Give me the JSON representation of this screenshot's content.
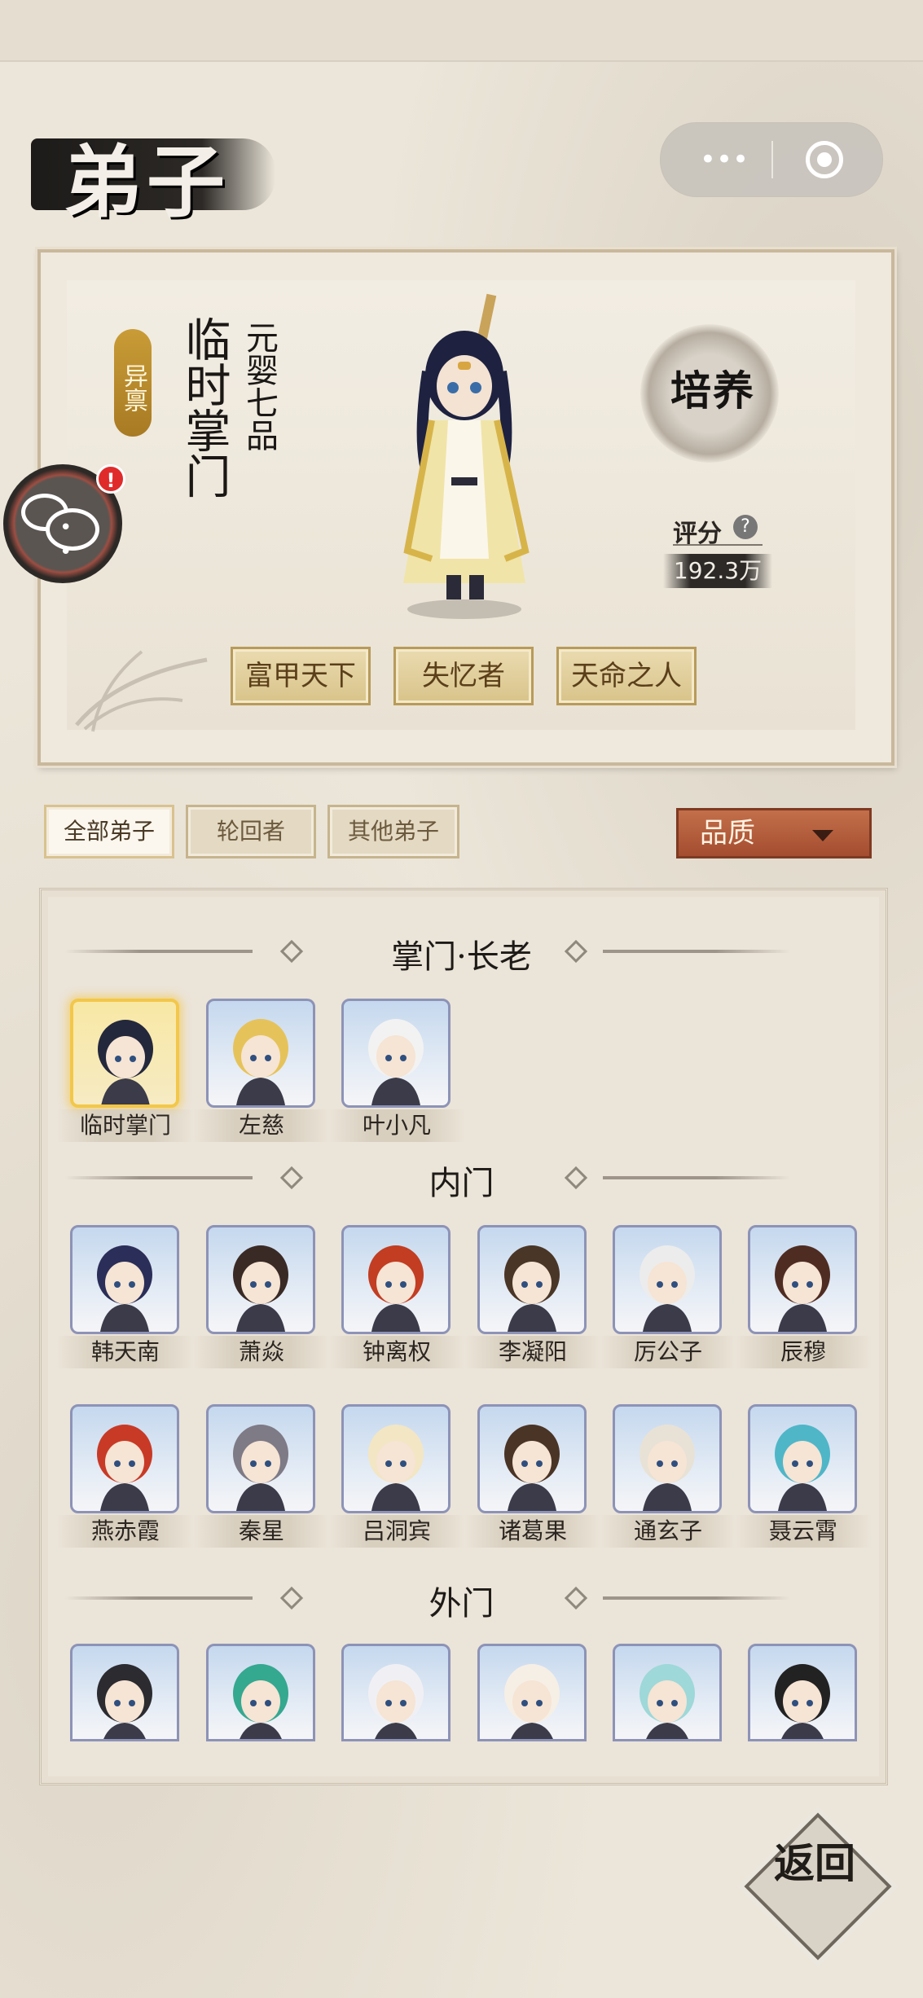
{
  "header": {
    "title": "弟子",
    "capsule": {
      "more_icon": "more-dots-icon",
      "close_icon": "target-circle-icon"
    }
  },
  "hero": {
    "aptitude_tag": "异禀",
    "name": "临时掌门",
    "rank": "元婴七品",
    "cultivate_label": "培养",
    "score_label": "评分",
    "score_help": "?",
    "score_value": "192.3万",
    "traits": [
      "富甲天下",
      "失忆者",
      "天命之人"
    ]
  },
  "chat": {
    "badge": "!"
  },
  "filters": {
    "tabs": [
      "全部弟子",
      "轮回者",
      "其他弟子"
    ],
    "active_index": 0,
    "quality_label": "品质"
  },
  "roster": {
    "sections": [
      {
        "title": "掌门·长老",
        "members": [
          "临时掌门",
          "左慈",
          "叶小凡"
        ]
      },
      {
        "title": "内门",
        "members": [
          "韩天南",
          "萧焱",
          "钟离权",
          "李凝阳",
          "厉公子",
          "辰穆",
          "燕赤霞",
          "秦星",
          "吕洞宾",
          "诸葛果",
          "通玄子",
          "聂云霄"
        ]
      },
      {
        "title": "外门",
        "members": [
          "",
          "",
          "",
          "",
          "",
          ""
        ]
      }
    ]
  },
  "back": {
    "label": "返回"
  },
  "colors": {
    "accent": "#c99c37",
    "quality_button": "#b35c3c",
    "frame_gold": "#f2c74a"
  }
}
